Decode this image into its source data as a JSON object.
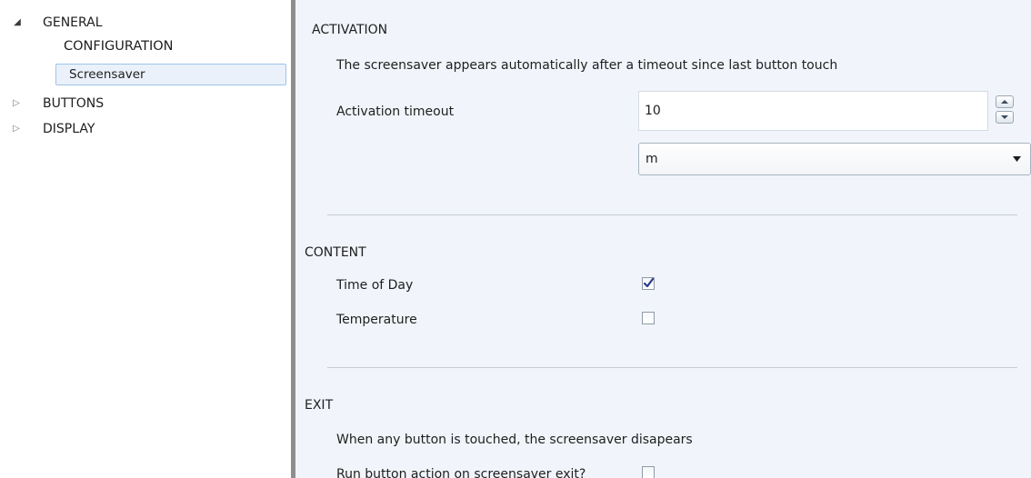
{
  "tree": {
    "general": {
      "label": "GENERAL",
      "expanded": true
    },
    "configuration": {
      "label": "CONFIGURATION"
    },
    "screensaver": {
      "label": "Screensaver",
      "selected": true
    },
    "buttons": {
      "label": "BUTTONS",
      "expanded": false
    },
    "display": {
      "label": "DISPLAY",
      "expanded": false
    }
  },
  "activation": {
    "title": "ACTIVATION",
    "description": "The screensaver appears automatically after a timeout since last button touch",
    "timeout_label": "Activation timeout",
    "timeout_value": "10",
    "unit_value": "m"
  },
  "content": {
    "title": "CONTENT",
    "time_of_day_label": "Time of Day",
    "time_of_day_checked": true,
    "temperature_label": "Temperature",
    "temperature_checked": false
  },
  "exit": {
    "title": "EXIT",
    "description": "When any button is touched, the screensaver disapears",
    "run_action_label": "Run button action on screensaver exit?",
    "run_action_checked": false
  },
  "colors": {
    "panel_background": "#f1f5fb",
    "selection_fill": "#eaf1fb",
    "selection_border": "#9fc3ea",
    "splitter": "#8e8e8e",
    "checkmark": "#2b3a8c"
  },
  "icons": {
    "expanded": "triangle-down-right-icon",
    "collapsed": "triangle-right-outline-icon",
    "spin_up": "arrow-up-icon",
    "spin_down": "arrow-down-icon",
    "dropdown": "caret-down-icon",
    "check": "checkmark-icon"
  }
}
